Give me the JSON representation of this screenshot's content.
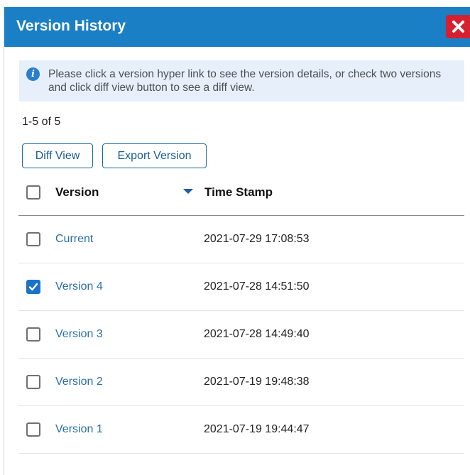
{
  "dialog": {
    "title": "Version History",
    "close_icon": "close-x-icon",
    "colors": {
      "header": "#1a7fc4",
      "close": "#d6202f",
      "link": "#2a6fa8"
    }
  },
  "info": {
    "icon": "info-icon",
    "text": "Please click a version hyper link to see the version details, or check two versions and click diff view button to see a diff view."
  },
  "pagination": {
    "range": "1-5 of 5"
  },
  "toolbar": {
    "diff_label": "Diff View",
    "export_label": "Export Version"
  },
  "table": {
    "headers": {
      "version": "Version",
      "timestamp": "Time Stamp"
    },
    "sort_icon": "sort-descending-icon",
    "select_all_checked": false,
    "rows": [
      {
        "version": "Current",
        "timestamp": "2021-07-29 17:08:53",
        "checked": false
      },
      {
        "version": "Version 4",
        "timestamp": "2021-07-28 14:51:50",
        "checked": true
      },
      {
        "version": "Version 3",
        "timestamp": "2021-07-28 14:49:40",
        "checked": false
      },
      {
        "version": "Version 2",
        "timestamp": "2021-07-19 19:48:38",
        "checked": false
      },
      {
        "version": "Version 1",
        "timestamp": "2021-07-19 19:44:47",
        "checked": false
      }
    ]
  }
}
